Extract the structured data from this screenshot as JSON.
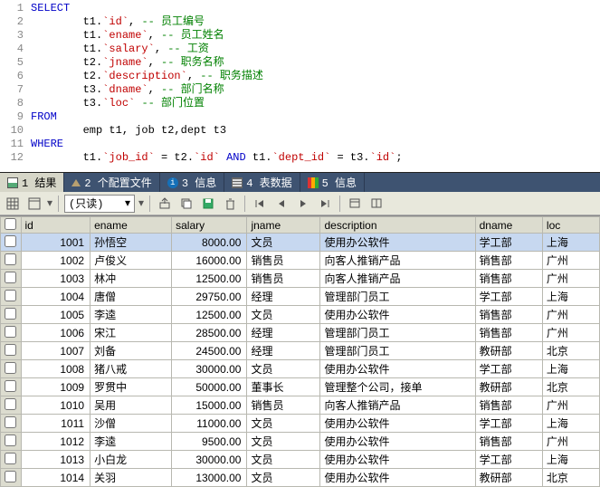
{
  "editor": {
    "lines": [
      "1",
      "2",
      "3",
      "4",
      "5",
      "6",
      "7",
      "8",
      "9",
      "10",
      "11",
      "12"
    ],
    "code_plain": "SELECT\n        t1.`id`, -- 员工编号\n        t1.`ename`, -- 员工姓名\n        t1.`salary`, -- 工资\n        t2.`jname`, -- 职务名称\n        t2.`description`, -- 职务描述\n        t3.`dname`, -- 部门名称\n        t3.`loc` -- 部门位置\nFROM\n        emp t1, job t2,dept t3\nWHERE\n        t1.`job_id` = t2.`id` AND t1.`dept_id` = t3.`id`;"
  },
  "tabs": {
    "t1": "1 结果",
    "t2": "2 个配置文件",
    "t3": "3 信息",
    "t4": "4 表数据",
    "t5": "5 信息"
  },
  "toolbar": {
    "mode_label": "(只读)"
  },
  "columns": {
    "id": "id",
    "ename": "ename",
    "salary": "salary",
    "jname": "jname",
    "description": "description",
    "dname": "dname",
    "loc": "loc"
  },
  "rows": [
    {
      "id": "1001",
      "ename": "孙悟空",
      "salary": "8000.00",
      "jname": "文员",
      "description": "使用办公软件",
      "dname": "学工部",
      "loc": "上海"
    },
    {
      "id": "1002",
      "ename": "卢俊义",
      "salary": "16000.00",
      "jname": "销售员",
      "description": "向客人推销产品",
      "dname": "销售部",
      "loc": "广州"
    },
    {
      "id": "1003",
      "ename": "林冲",
      "salary": "12500.00",
      "jname": "销售员",
      "description": "向客人推销产品",
      "dname": "销售部",
      "loc": "广州"
    },
    {
      "id": "1004",
      "ename": "唐僧",
      "salary": "29750.00",
      "jname": "经理",
      "description": "管理部门员工",
      "dname": "学工部",
      "loc": "上海"
    },
    {
      "id": "1005",
      "ename": "李逵",
      "salary": "12500.00",
      "jname": "文员",
      "description": "使用办公软件",
      "dname": "销售部",
      "loc": "广州"
    },
    {
      "id": "1006",
      "ename": "宋江",
      "salary": "28500.00",
      "jname": "经理",
      "description": "管理部门员工",
      "dname": "销售部",
      "loc": "广州"
    },
    {
      "id": "1007",
      "ename": "刘备",
      "salary": "24500.00",
      "jname": "经理",
      "description": "管理部门员工",
      "dname": "教研部",
      "loc": "北京"
    },
    {
      "id": "1008",
      "ename": "猪八戒",
      "salary": "30000.00",
      "jname": "文员",
      "description": "使用办公软件",
      "dname": "学工部",
      "loc": "上海"
    },
    {
      "id": "1009",
      "ename": "罗贯中",
      "salary": "50000.00",
      "jname": "董事长",
      "description": "管理整个公司，接单",
      "dname": "教研部",
      "loc": "北京"
    },
    {
      "id": "1010",
      "ename": "吴用",
      "salary": "15000.00",
      "jname": "销售员",
      "description": "向客人推销产品",
      "dname": "销售部",
      "loc": "广州"
    },
    {
      "id": "1011",
      "ename": "沙僧",
      "salary": "11000.00",
      "jname": "文员",
      "description": "使用办公软件",
      "dname": "学工部",
      "loc": "上海"
    },
    {
      "id": "1012",
      "ename": "李逵",
      "salary": "9500.00",
      "jname": "文员",
      "description": "使用办公软件",
      "dname": "销售部",
      "loc": "广州"
    },
    {
      "id": "1013",
      "ename": "小白龙",
      "salary": "30000.00",
      "jname": "文员",
      "description": "使用办公软件",
      "dname": "学工部",
      "loc": "上海"
    },
    {
      "id": "1014",
      "ename": "关羽",
      "salary": "13000.00",
      "jname": "文员",
      "description": "使用办公软件",
      "dname": "教研部",
      "loc": "北京"
    }
  ],
  "selected_row_index": 0
}
